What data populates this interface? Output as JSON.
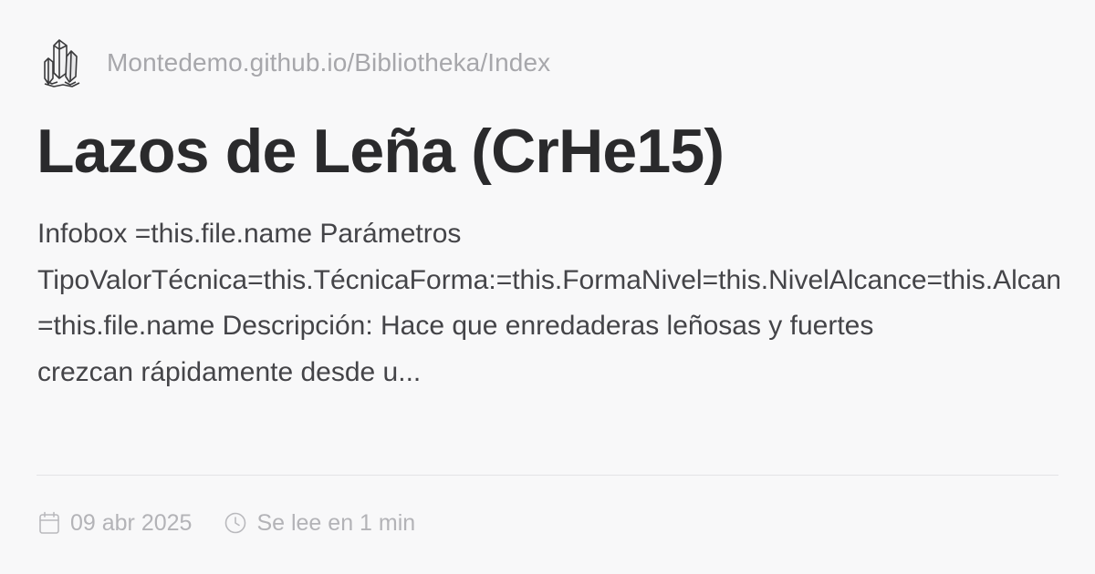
{
  "site": {
    "logo_icon": "crystal-cluster-icon",
    "url": "Montedemo.github.io/Bibliotheka/Index"
  },
  "page": {
    "title": "Lazos de Leña (CrHe15)"
  },
  "description": {
    "lines": [
      "Infobox =this.file.name Parámetros",
      "TipoValorTécnica=this.TécnicaForma:=this.FormaNivel=this.NivelAlcance=this.Alcance",
      "=this.file.name Descripción: Hace que enredaderas leñosas y fuertes",
      "crezcan rápidamente desde u..."
    ]
  },
  "meta": {
    "date_icon": "calendar-icon",
    "date": "09 abr 2025",
    "read_icon": "clock-icon",
    "read_time": "Se lee en 1 min"
  },
  "colors": {
    "background": "#f8f8f9",
    "title": "#2a2a2c",
    "body_text": "#444448",
    "muted_text": "#a7a7ab"
  }
}
